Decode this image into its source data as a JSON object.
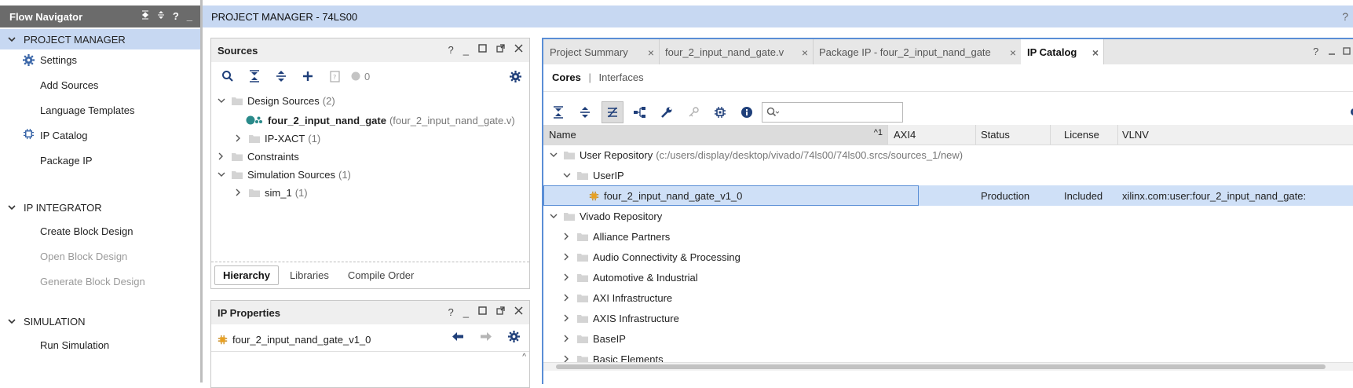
{
  "flow_navigator": {
    "title": "Flow Navigator",
    "controls": [
      "collapse-all-icon",
      "expand-all-icon",
      "help-icon",
      "minimize-icon"
    ],
    "sections": [
      {
        "label": "PROJECT MANAGER",
        "items": [
          {
            "label": "Settings",
            "icon": "gear-icon",
            "enabled": true
          },
          {
            "label": "Add Sources",
            "enabled": true
          },
          {
            "label": "Language Templates",
            "enabled": true
          },
          {
            "label": "IP Catalog",
            "icon": "ip-chip-icon",
            "enabled": true
          },
          {
            "label": "Package IP",
            "enabled": true
          }
        ]
      },
      {
        "label": "IP INTEGRATOR",
        "items": [
          {
            "label": "Create Block Design",
            "enabled": true
          },
          {
            "label": "Open Block Design",
            "enabled": false
          },
          {
            "label": "Generate Block Design",
            "enabled": false
          }
        ]
      },
      {
        "label": "SIMULATION",
        "items": [
          {
            "label": "Run Simulation",
            "enabled": true
          }
        ]
      }
    ]
  },
  "header": {
    "title": "PROJECT MANAGER - 74LS00",
    "help": "?"
  },
  "sources": {
    "title": "Sources",
    "status_count": "0",
    "tree": [
      {
        "label": "Design Sources",
        "count": "(2)",
        "expanded": true
      },
      {
        "label": "four_2_input_nand_gate",
        "suffix": "(four_2_input_nand_gate.v)"
      },
      {
        "label": "IP-XACT",
        "count": "(1)"
      },
      {
        "label": "Constraints"
      },
      {
        "label": "Simulation Sources",
        "count": "(1)",
        "expanded": true
      },
      {
        "label": "sim_1",
        "count": "(1)"
      }
    ],
    "tabs": [
      "Hierarchy",
      "Libraries",
      "Compile Order"
    ],
    "active_tab": "Hierarchy"
  },
  "ip_properties": {
    "title": "IP Properties",
    "item": "four_2_input_nand_gate_v1_0"
  },
  "editor_tabs": [
    {
      "label": "Project Summary",
      "active": false
    },
    {
      "label": "four_2_input_nand_gate.v",
      "active": false
    },
    {
      "label": "Package IP - four_2_input_nand_gate",
      "active": false
    },
    {
      "label": "IP Catalog",
      "active": true
    }
  ],
  "ip_catalog": {
    "subtabs": {
      "cores": "Cores",
      "divider": "|",
      "interfaces": "Interfaces"
    },
    "search_placeholder": "",
    "columns": [
      "Name",
      "AXI4",
      "Status",
      "License",
      "VLNV"
    ],
    "sort_indicator": "^1",
    "rows": [
      {
        "level": 0,
        "label": "User Repository",
        "detail": "(c:/users/display/desktop/vivado/74ls00/74ls00.srcs/sources_1/new)",
        "expanded": true
      },
      {
        "level": 1,
        "label": "UserIP",
        "expanded": true
      },
      {
        "level": 2,
        "label": "four_2_input_nand_gate_v1_0",
        "status": "Production",
        "license": "Included",
        "vlnv": "xilinx.com:user:four_2_input_nand_gate:",
        "selected": true
      },
      {
        "level": 0,
        "label": "Vivado Repository",
        "expanded": true
      },
      {
        "level": 1,
        "label": "Alliance Partners"
      },
      {
        "level": 1,
        "label": "Audio Connectivity & Processing"
      },
      {
        "level": 1,
        "label": "Automotive & Industrial"
      },
      {
        "level": 1,
        "label": "AXI Infrastructure"
      },
      {
        "level": 1,
        "label": "AXIS Infrastructure"
      },
      {
        "level": 1,
        "label": "BaseIP"
      },
      {
        "level": 1,
        "label": "Basic Elements"
      }
    ]
  },
  "colors": {
    "accent": "#5a8ed6",
    "title_bar": "#c7d8f2",
    "selection": "#cfe0f7",
    "nav_header": "#6b6b6b"
  }
}
